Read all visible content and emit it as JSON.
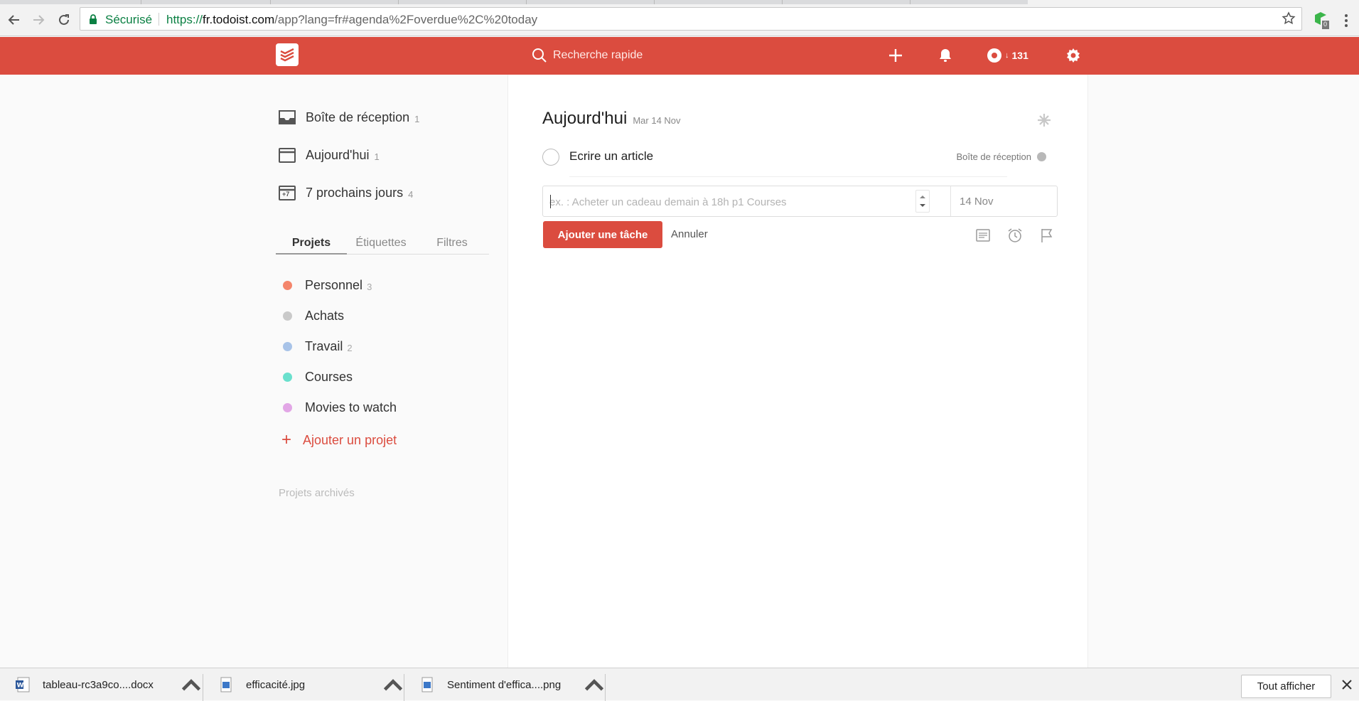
{
  "browser": {
    "secure_label": "Sécurisé",
    "url_scheme": "https://",
    "url_domain": "fr.todoist.com",
    "url_path": "/app?lang=fr#agenda%2Foverdue%2C%20today",
    "extension_badge": "0"
  },
  "appbar": {
    "search_placeholder": "Recherche rapide",
    "karma": "131",
    "brand_color": "#db4c3f"
  },
  "sidebar": {
    "filters": [
      {
        "label": "Boîte de réception",
        "count": "1",
        "icon": "inbox-icon"
      },
      {
        "label": "Aujourd'hui",
        "count": "1",
        "icon": "calendar-today-icon"
      },
      {
        "label": "7 prochains jours",
        "count": "4",
        "icon": "calendar-week-icon",
        "badge": "+7"
      }
    ],
    "tabs": [
      "Projets",
      "Étiquettes",
      "Filtres"
    ],
    "active_tab": "Projets",
    "projects": [
      {
        "label": "Personnel",
        "count": "3",
        "color": "#f4856b"
      },
      {
        "label": "Achats",
        "count": "",
        "color": "#c9c9c9"
      },
      {
        "label": "Travail",
        "count": "2",
        "color": "#a8c3e8"
      },
      {
        "label": "Courses",
        "count": "",
        "color": "#6ae0cd"
      },
      {
        "label": "Movies to watch",
        "count": "",
        "color": "#e2a6e6"
      }
    ],
    "add_project": "Ajouter un projet",
    "archived": "Projets archivés"
  },
  "main": {
    "title": "Aujourd'hui",
    "date": "Mar 14 Nov",
    "tasks": [
      {
        "text": "Ecrire un article",
        "project": "Boîte de réception"
      }
    ],
    "editor": {
      "placeholder": "ex. : Acheter un cadeau demain à 18h p1 Courses",
      "date_value": "14 Nov",
      "add_button": "Ajouter une tâche",
      "cancel": "Annuler"
    }
  },
  "downloads": {
    "items": [
      {
        "name": "tableau-rc3a9co....docx",
        "icon": "word-file-icon"
      },
      {
        "name": "efficacité.jpg",
        "icon": "image-file-icon"
      },
      {
        "name": "Sentiment d'effica....png",
        "icon": "image-file-icon"
      }
    ],
    "show_all": "Tout afficher"
  }
}
